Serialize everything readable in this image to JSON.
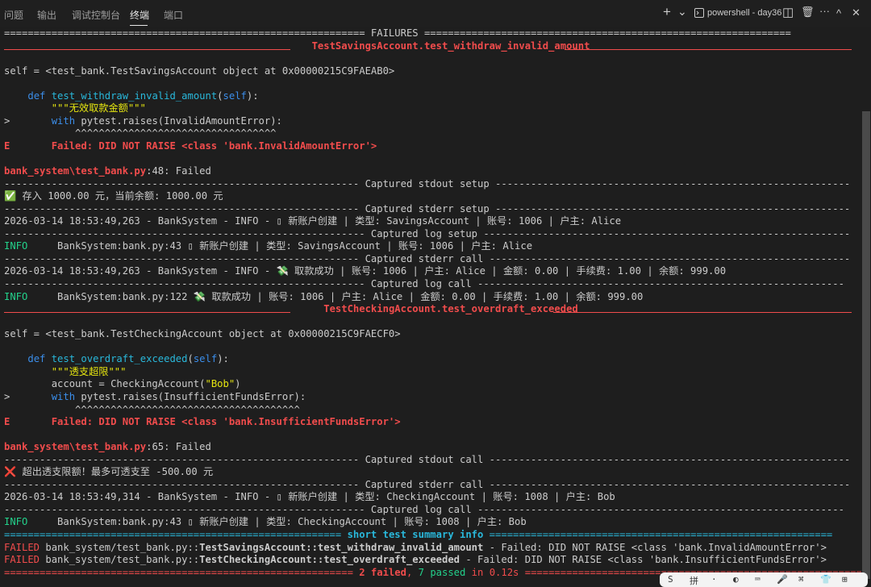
{
  "panel": {
    "tabs": [
      "问题",
      "输出",
      "调试控制台",
      "终端",
      "端口"
    ],
    "active_tab": "终端"
  },
  "toolbar": {
    "add": "+",
    "dropdown": "⌄",
    "terminal_icon": "terminal-icon",
    "terminal_name": "powershell - day36",
    "split": "◫",
    "trash": "🗑",
    "more": "···",
    "collapse": "^",
    "close": "✕"
  },
  "lines": [
    {
      "segs": [
        {
          "t": "============================================================= FAILURES =============================================================="
        }
      ]
    },
    {
      "segs": [
        {
          "t": "                                                    ",
          "c": "red"
        },
        {
          "t": "TestSavingsAccount.test_withdraw_invalid_amount",
          "c": "redb"
        }
      ],
      "sep": true
    },
    {
      "segs": [
        {
          "t": ""
        }
      ]
    },
    {
      "segs": [
        {
          "t": "self = <test_bank.TestSavingsAccount object at 0x00000215C9FAEAB0>"
        }
      ]
    },
    {
      "segs": [
        {
          "t": ""
        }
      ]
    },
    {
      "segs": [
        {
          "t": "    "
        },
        {
          "t": "def ",
          "c": "blue"
        },
        {
          "t": "test_withdraw_invalid_amount",
          "c": "cyan"
        },
        {
          "t": "("
        },
        {
          "t": "self",
          "c": "blue"
        },
        {
          "t": "):"
        }
      ]
    },
    {
      "segs": [
        {
          "t": "        \"\"\"无效取款金额\"\"\"",
          "c": "yellow"
        }
      ]
    },
    {
      "segs": [
        {
          "t": ">       "
        },
        {
          "t": "with ",
          "c": "blue"
        },
        {
          "t": "pytest.raises(InvalidAmountError):"
        }
      ]
    },
    {
      "segs": [
        {
          "t": "            ^^^^^^^^^^^^^^^^^^^^^^^^^^^^^^^^^^"
        }
      ]
    },
    {
      "segs": [
        {
          "t": "E       Failed: DID NOT RAISE <class 'bank.InvalidAmountError'>",
          "c": "redb"
        }
      ]
    },
    {
      "segs": [
        {
          "t": ""
        }
      ]
    },
    {
      "segs": [
        {
          "t": "bank_system\\test_bank.py",
          "c": "redb"
        },
        {
          "t": ":48: Failed"
        }
      ]
    },
    {
      "segs": [
        {
          "t": "------------------------------------------------------------ Captured stdout setup ------------------------------------------------------------"
        }
      ]
    },
    {
      "segs": [
        {
          "t": "✅",
          "c": "green"
        },
        {
          "t": " 存入 1000.00 元，当前余额: 1000.00 元"
        }
      ]
    },
    {
      "segs": [
        {
          "t": "------------------------------------------------------------ Captured stderr setup ------------------------------------------------------------"
        }
      ]
    },
    {
      "segs": [
        {
          "t": "2026-03-14 18:53:49,263 - BankSystem - INFO - ▯ 新账户创建 | 类型: SavingsAccount | 账号: 1006 | 户主: Alice"
        }
      ]
    },
    {
      "segs": [
        {
          "t": "------------------------------------------------------------- Captured log setup --------------------------------------------------------------"
        }
      ]
    },
    {
      "segs": [
        {
          "t": "INFO    ",
          "c": "green"
        },
        {
          "t": " BankSystem:bank.py:43 ▯ 新账户创建 | 类型: SavingsAccount | 账号: 1006 | 户主: Alice"
        }
      ]
    },
    {
      "segs": [
        {
          "t": "------------------------------------------------------------ Captured stderr call -------------------------------------------------------------"
        }
      ]
    },
    {
      "segs": [
        {
          "t": "2026-03-14 18:53:49,263 - BankSystem - INFO - "
        },
        {
          "t": "💸",
          "c": "green"
        },
        {
          "t": " 取款成功 | 账号: 1006 | 户主: Alice | 金额: 0.00 | 手续费: 1.00 | 余额: 999.00"
        }
      ]
    },
    {
      "segs": [
        {
          "t": "------------------------------------------------------------- Captured log call --------------------------------------------------------------"
        }
      ]
    },
    {
      "segs": [
        {
          "t": "INFO    ",
          "c": "green"
        },
        {
          "t": " BankSystem:bank.py:122 "
        },
        {
          "t": "💸",
          "c": "green"
        },
        {
          "t": " 取款成功 | 账号: 1006 | 户主: Alice | 金额: 0.00 | 手续费: 1.00 | 余额: 999.00"
        }
      ]
    },
    {
      "segs": [
        {
          "t": "                                                      ",
          "c": "red"
        },
        {
          "t": "TestCheckingAccount.test_overdraft_exceeded",
          "c": "redb"
        }
      ],
      "sep": true
    },
    {
      "segs": [
        {
          "t": ""
        }
      ]
    },
    {
      "segs": [
        {
          "t": "self = <test_bank.TestCheckingAccount object at 0x00000215C9FAECF0>"
        }
      ]
    },
    {
      "segs": [
        {
          "t": ""
        }
      ]
    },
    {
      "segs": [
        {
          "t": "    "
        },
        {
          "t": "def ",
          "c": "blue"
        },
        {
          "t": "test_overdraft_exceeded",
          "c": "cyan"
        },
        {
          "t": "("
        },
        {
          "t": "self",
          "c": "blue"
        },
        {
          "t": "):"
        }
      ]
    },
    {
      "segs": [
        {
          "t": "        \"\"\"透支超限\"\"\"",
          "c": "yellow"
        }
      ]
    },
    {
      "segs": [
        {
          "t": "        account = CheckingAccount("
        },
        {
          "t": "\"Bob\"",
          "c": "yellow"
        },
        {
          "t": ")"
        }
      ]
    },
    {
      "segs": [
        {
          "t": ">       "
        },
        {
          "t": "with ",
          "c": "blue"
        },
        {
          "t": "pytest.raises(InsufficientFundsError):"
        }
      ]
    },
    {
      "segs": [
        {
          "t": "            ^^^^^^^^^^^^^^^^^^^^^^^^^^^^^^^^^^^^^^"
        }
      ]
    },
    {
      "segs": [
        {
          "t": "E       Failed: DID NOT RAISE <class 'bank.InsufficientFundsError'>",
          "c": "redb"
        }
      ]
    },
    {
      "segs": [
        {
          "t": ""
        }
      ]
    },
    {
      "segs": [
        {
          "t": "bank_system\\test_bank.py",
          "c": "redb"
        },
        {
          "t": ":65: Failed"
        }
      ]
    },
    {
      "segs": [
        {
          "t": "------------------------------------------------------------ Captured stdout call -------------------------------------------------------------"
        }
      ]
    },
    {
      "segs": [
        {
          "t": "❌",
          "c": "red"
        },
        {
          "t": " 超出透支限额！最多可透支至 -500.00 元"
        }
      ]
    },
    {
      "segs": [
        {
          "t": "------------------------------------------------------------ Captured stderr call -------------------------------------------------------------"
        }
      ]
    },
    {
      "segs": [
        {
          "t": "2026-03-14 18:53:49,314 - BankSystem - INFO - ▯ 新账户创建 | 类型: CheckingAccount | 账号: 1008 | 户主: Bob"
        }
      ]
    },
    {
      "segs": [
        {
          "t": "------------------------------------------------------------- Captured log call --------------------------------------------------------------"
        }
      ]
    },
    {
      "segs": [
        {
          "t": "INFO    ",
          "c": "green"
        },
        {
          "t": " BankSystem:bank.py:43 ▯ 新账户创建 | 类型: CheckingAccount | 账号: 1008 | 户主: Bob"
        }
      ]
    },
    {
      "segs": [
        {
          "t": "========================================================= ",
          "c": "cyan"
        },
        {
          "t": "short test summary info",
          "c": "cyanb"
        },
        {
          "t": " ==========================================================",
          "c": "cyan"
        }
      ]
    },
    {
      "segs": [
        {
          "t": "FAILED ",
          "c": "red"
        },
        {
          "t": "bank_system/test_bank.py::"
        },
        {
          "t": "TestSavingsAccount::test_withdraw_invalid_amount",
          "c": "bold"
        },
        {
          "t": " - Failed: DID NOT RAISE <class 'bank.InvalidAmountError'>"
        }
      ]
    },
    {
      "segs": [
        {
          "t": "FAILED ",
          "c": "red"
        },
        {
          "t": "bank_system/test_bank.py::"
        },
        {
          "t": "TestCheckingAccount::test_overdraft_exceeded",
          "c": "bold"
        },
        {
          "t": " - Failed: DID NOT RAISE <class 'bank.InsufficientFundsError'>"
        }
      ]
    },
    {
      "segs": [
        {
          "t": "=========================================================== ",
          "c": "red"
        },
        {
          "t": "2 failed",
          "c": "redb"
        },
        {
          "t": ", ",
          "c": "red"
        },
        {
          "t": "7 passed",
          "c": "green"
        },
        {
          "t": " in 0.12s",
          "c": "red"
        },
        {
          "t": " ==============================================================",
          "c": "red"
        }
      ]
    }
  ],
  "floatbar": {
    "items": [
      "S",
      "拼",
      "·",
      "◐",
      "⌨",
      "🎤",
      "⌘",
      "👕",
      "⊞"
    ]
  },
  "colors": {
    "background": "#1e1e1e",
    "red": "#f14c4c",
    "blue": "#3b8eea",
    "yellow": "#e5e510",
    "cyan": "#29b8db",
    "green": "#23d18b"
  }
}
